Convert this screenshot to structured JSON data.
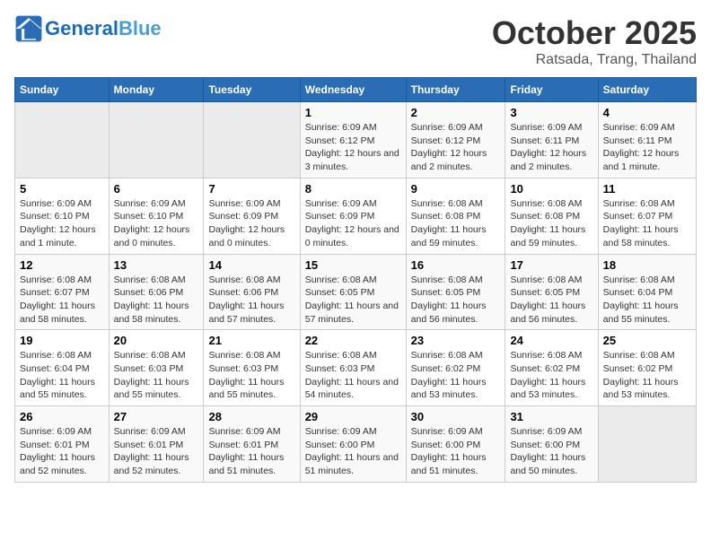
{
  "header": {
    "logo_general": "General",
    "logo_blue": "Blue",
    "month": "October 2025",
    "location": "Ratsada, Trang, Thailand"
  },
  "days_of_week": [
    "Sunday",
    "Monday",
    "Tuesday",
    "Wednesday",
    "Thursday",
    "Friday",
    "Saturday"
  ],
  "weeks": [
    [
      {
        "day": "",
        "info": ""
      },
      {
        "day": "",
        "info": ""
      },
      {
        "day": "",
        "info": ""
      },
      {
        "day": "1",
        "info": "Sunrise: 6:09 AM\nSunset: 6:12 PM\nDaylight: 12 hours and 3 minutes."
      },
      {
        "day": "2",
        "info": "Sunrise: 6:09 AM\nSunset: 6:12 PM\nDaylight: 12 hours and 2 minutes."
      },
      {
        "day": "3",
        "info": "Sunrise: 6:09 AM\nSunset: 6:11 PM\nDaylight: 12 hours and 2 minutes."
      },
      {
        "day": "4",
        "info": "Sunrise: 6:09 AM\nSunset: 6:11 PM\nDaylight: 12 hours and 1 minute."
      }
    ],
    [
      {
        "day": "5",
        "info": "Sunrise: 6:09 AM\nSunset: 6:10 PM\nDaylight: 12 hours and 1 minute."
      },
      {
        "day": "6",
        "info": "Sunrise: 6:09 AM\nSunset: 6:10 PM\nDaylight: 12 hours and 0 minutes."
      },
      {
        "day": "7",
        "info": "Sunrise: 6:09 AM\nSunset: 6:09 PM\nDaylight: 12 hours and 0 minutes."
      },
      {
        "day": "8",
        "info": "Sunrise: 6:09 AM\nSunset: 6:09 PM\nDaylight: 12 hours and 0 minutes."
      },
      {
        "day": "9",
        "info": "Sunrise: 6:08 AM\nSunset: 6:08 PM\nDaylight: 11 hours and 59 minutes."
      },
      {
        "day": "10",
        "info": "Sunrise: 6:08 AM\nSunset: 6:08 PM\nDaylight: 11 hours and 59 minutes."
      },
      {
        "day": "11",
        "info": "Sunrise: 6:08 AM\nSunset: 6:07 PM\nDaylight: 11 hours and 58 minutes."
      }
    ],
    [
      {
        "day": "12",
        "info": "Sunrise: 6:08 AM\nSunset: 6:07 PM\nDaylight: 11 hours and 58 minutes."
      },
      {
        "day": "13",
        "info": "Sunrise: 6:08 AM\nSunset: 6:06 PM\nDaylight: 11 hours and 58 minutes."
      },
      {
        "day": "14",
        "info": "Sunrise: 6:08 AM\nSunset: 6:06 PM\nDaylight: 11 hours and 57 minutes."
      },
      {
        "day": "15",
        "info": "Sunrise: 6:08 AM\nSunset: 6:05 PM\nDaylight: 11 hours and 57 minutes."
      },
      {
        "day": "16",
        "info": "Sunrise: 6:08 AM\nSunset: 6:05 PM\nDaylight: 11 hours and 56 minutes."
      },
      {
        "day": "17",
        "info": "Sunrise: 6:08 AM\nSunset: 6:05 PM\nDaylight: 11 hours and 56 minutes."
      },
      {
        "day": "18",
        "info": "Sunrise: 6:08 AM\nSunset: 6:04 PM\nDaylight: 11 hours and 55 minutes."
      }
    ],
    [
      {
        "day": "19",
        "info": "Sunrise: 6:08 AM\nSunset: 6:04 PM\nDaylight: 11 hours and 55 minutes."
      },
      {
        "day": "20",
        "info": "Sunrise: 6:08 AM\nSunset: 6:03 PM\nDaylight: 11 hours and 55 minutes."
      },
      {
        "day": "21",
        "info": "Sunrise: 6:08 AM\nSunset: 6:03 PM\nDaylight: 11 hours and 55 minutes."
      },
      {
        "day": "22",
        "info": "Sunrise: 6:08 AM\nSunset: 6:03 PM\nDaylight: 11 hours and 54 minutes."
      },
      {
        "day": "23",
        "info": "Sunrise: 6:08 AM\nSunset: 6:02 PM\nDaylight: 11 hours and 53 minutes."
      },
      {
        "day": "24",
        "info": "Sunrise: 6:08 AM\nSunset: 6:02 PM\nDaylight: 11 hours and 53 minutes."
      },
      {
        "day": "25",
        "info": "Sunrise: 6:08 AM\nSunset: 6:02 PM\nDaylight: 11 hours and 53 minutes."
      }
    ],
    [
      {
        "day": "26",
        "info": "Sunrise: 6:09 AM\nSunset: 6:01 PM\nDaylight: 11 hours and 52 minutes."
      },
      {
        "day": "27",
        "info": "Sunrise: 6:09 AM\nSunset: 6:01 PM\nDaylight: 11 hours and 52 minutes."
      },
      {
        "day": "28",
        "info": "Sunrise: 6:09 AM\nSunset: 6:01 PM\nDaylight: 11 hours and 51 minutes."
      },
      {
        "day": "29",
        "info": "Sunrise: 6:09 AM\nSunset: 6:00 PM\nDaylight: 11 hours and 51 minutes."
      },
      {
        "day": "30",
        "info": "Sunrise: 6:09 AM\nSunset: 6:00 PM\nDaylight: 11 hours and 51 minutes."
      },
      {
        "day": "31",
        "info": "Sunrise: 6:09 AM\nSunset: 6:00 PM\nDaylight: 11 hours and 50 minutes."
      },
      {
        "day": "",
        "info": ""
      }
    ]
  ]
}
